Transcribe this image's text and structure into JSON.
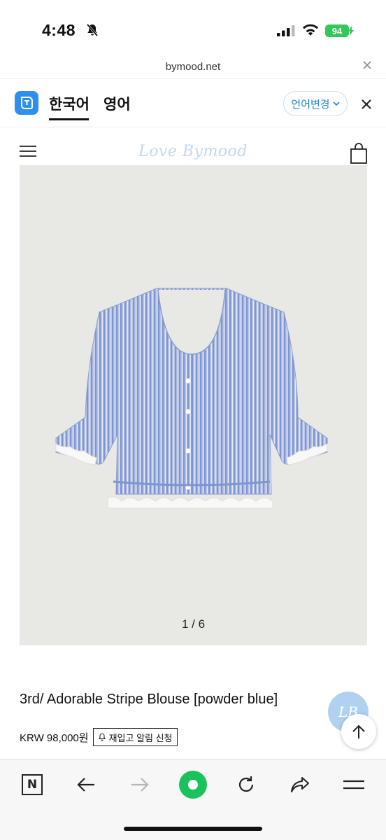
{
  "status_bar": {
    "time": "4:48",
    "battery": "94"
  },
  "browser": {
    "url": "bymood.net"
  },
  "translate_bar": {
    "tab_korean": "한국어",
    "tab_english": "영어",
    "change_language": "언어변경"
  },
  "site": {
    "logo": "Love Bymood"
  },
  "product": {
    "image_counter": "1 / 6",
    "title": "3rd/ Adorable Stripe Blouse [powder blue]",
    "price": "KRW 98,000원",
    "restock_label": "재입고 알림 신청"
  },
  "floating": {
    "logo_text": "LB"
  },
  "toolbar": {
    "naver_label": "N"
  },
  "colors": {
    "accent_blue": "#2f8ff0",
    "battery_green": "#34c759",
    "green_button": "#19c25a",
    "image_bg": "#e8e8e5",
    "blouse_blue": "#9aaee0"
  }
}
